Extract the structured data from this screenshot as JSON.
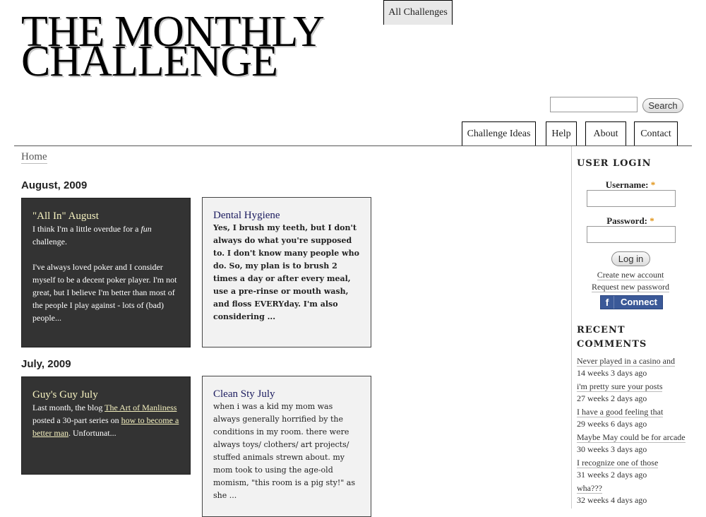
{
  "site": {
    "title_line1": "THE MONTHLY",
    "title_line2": "CHALLENGE"
  },
  "search": {
    "value": "",
    "button_label": "Search"
  },
  "nav": {
    "tabs": [
      {
        "label": "All Challenges",
        "active": true
      },
      {
        "label": "Challenge Ideas",
        "active": false
      },
      {
        "label": "Help",
        "active": false
      },
      {
        "label": "About",
        "active": false
      },
      {
        "label": "Contact",
        "active": false
      }
    ]
  },
  "breadcrumb": {
    "home": "Home"
  },
  "months": [
    {
      "heading": "August, 2009",
      "posts": [
        {
          "title": "\"All In\" August",
          "body_prefix": "I think I'm a little overdue for a ",
          "body_em": "fun",
          "body_suffix": " challenge.\n\nI've always loved poker and I consider myself to be a decent poker player. I'm not great, but I believe I'm better than most of the people I play against - lots of (bad) people..."
        },
        {
          "title": "Dental Hygiene",
          "body": "Yes, I brush my teeth, but I don't always do what you're supposed to. I don't know many people who do. So, my plan is to brush 2 times a day or after every meal, use a pre-rinse or mouth wash, and floss EVERYday. I'm also considering ..."
        }
      ]
    },
    {
      "heading": "July, 2009",
      "posts": [
        {
          "title": "Guy's Guy July",
          "body_prefix": "Last month, the blog ",
          "link1": "The Art of Manliness",
          "body_middle": " posted a 30-part series on ",
          "link2": "how to become a better man",
          "body_suffix": ". Unfortunat..."
        },
        {
          "title": "Clean Sty July",
          "body": "when i was a kid my mom was always generally horrified by the conditions in my room. there were always toys/ clothers/ art projects/ stuffed animals strewn about. my mom took to using the age-old momism, \"this room is a pig sty!\" as she ..."
        }
      ]
    }
  ],
  "sidebar": {
    "login": {
      "heading": "USER LOGIN",
      "username_label": "Username:",
      "password_label": "Password:",
      "required_mark": "*",
      "login_button": "Log in",
      "create_account": "Create new account",
      "request_password": "Request new password",
      "fb_icon": "f",
      "fb_label": "Connect"
    },
    "comments": {
      "heading_line1": "RECENT",
      "heading_line2": "COMMENTS",
      "items": [
        {
          "text": "Never played in a casino and",
          "ago": "14 weeks 3 days ago"
        },
        {
          "text": " i'm pretty sure your posts",
          "ago": "27 weeks 2 days ago"
        },
        {
          "text": "I have a good feeling that",
          "ago": "29 weeks 6 days ago"
        },
        {
          "text": "Maybe May could be for arcade",
          "ago": "30 weeks 3 days ago"
        },
        {
          "text": "I recognize one of those",
          "ago": "31 weeks 2 days ago"
        },
        {
          "text": "wha???",
          "ago": "32 weeks 4 days ago"
        }
      ]
    }
  },
  "colors": {
    "dark_card": "#333333",
    "light_card": "#f2f2f2",
    "dark_card_title": "#f6f2c0",
    "light_card_title": "#1a1a5e",
    "required": "#e09010",
    "facebook": "#3b5998"
  }
}
